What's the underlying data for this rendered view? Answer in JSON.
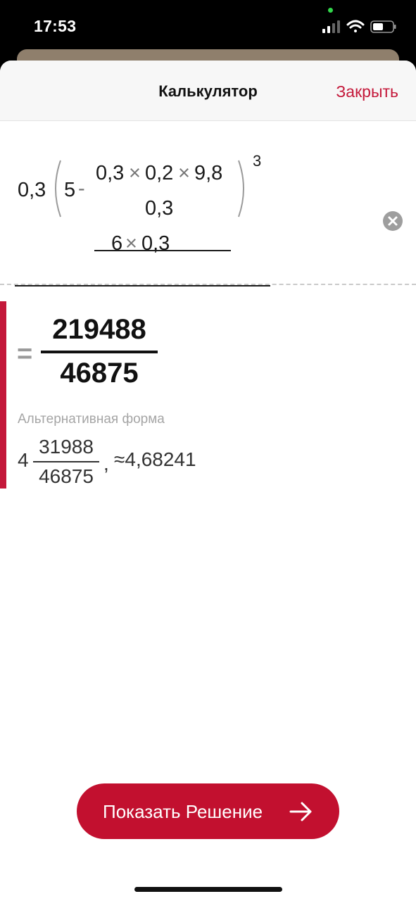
{
  "status": {
    "time": "17:53"
  },
  "header": {
    "title": "Калькулятор",
    "close_label": "Закрыть"
  },
  "expression": {
    "coef": "0,3",
    "five": "5",
    "minus": "-",
    "inner_a": "0,3",
    "times": "×",
    "inner_b": "0,2",
    "inner_c": "9,8",
    "inner_den": "0,3",
    "exponent": "3",
    "den_a": "6",
    "den_b": "0,3"
  },
  "result": {
    "numerator": "219488",
    "denominator": "46875",
    "equals": "=",
    "alt_label": "Альтернативная форма",
    "alt_whole": "4",
    "alt_numerator": "31988",
    "alt_denominator": "46875",
    "alt_comma": ",",
    "alt_approx": "≈4,68241"
  },
  "actions": {
    "show_solution_label": "Показать Решение"
  },
  "icons": {
    "clear": "clear-circle-icon",
    "arrow": "arrow-right-icon"
  },
  "colors": {
    "accent": "#c2102f",
    "link": "#c4183a"
  }
}
